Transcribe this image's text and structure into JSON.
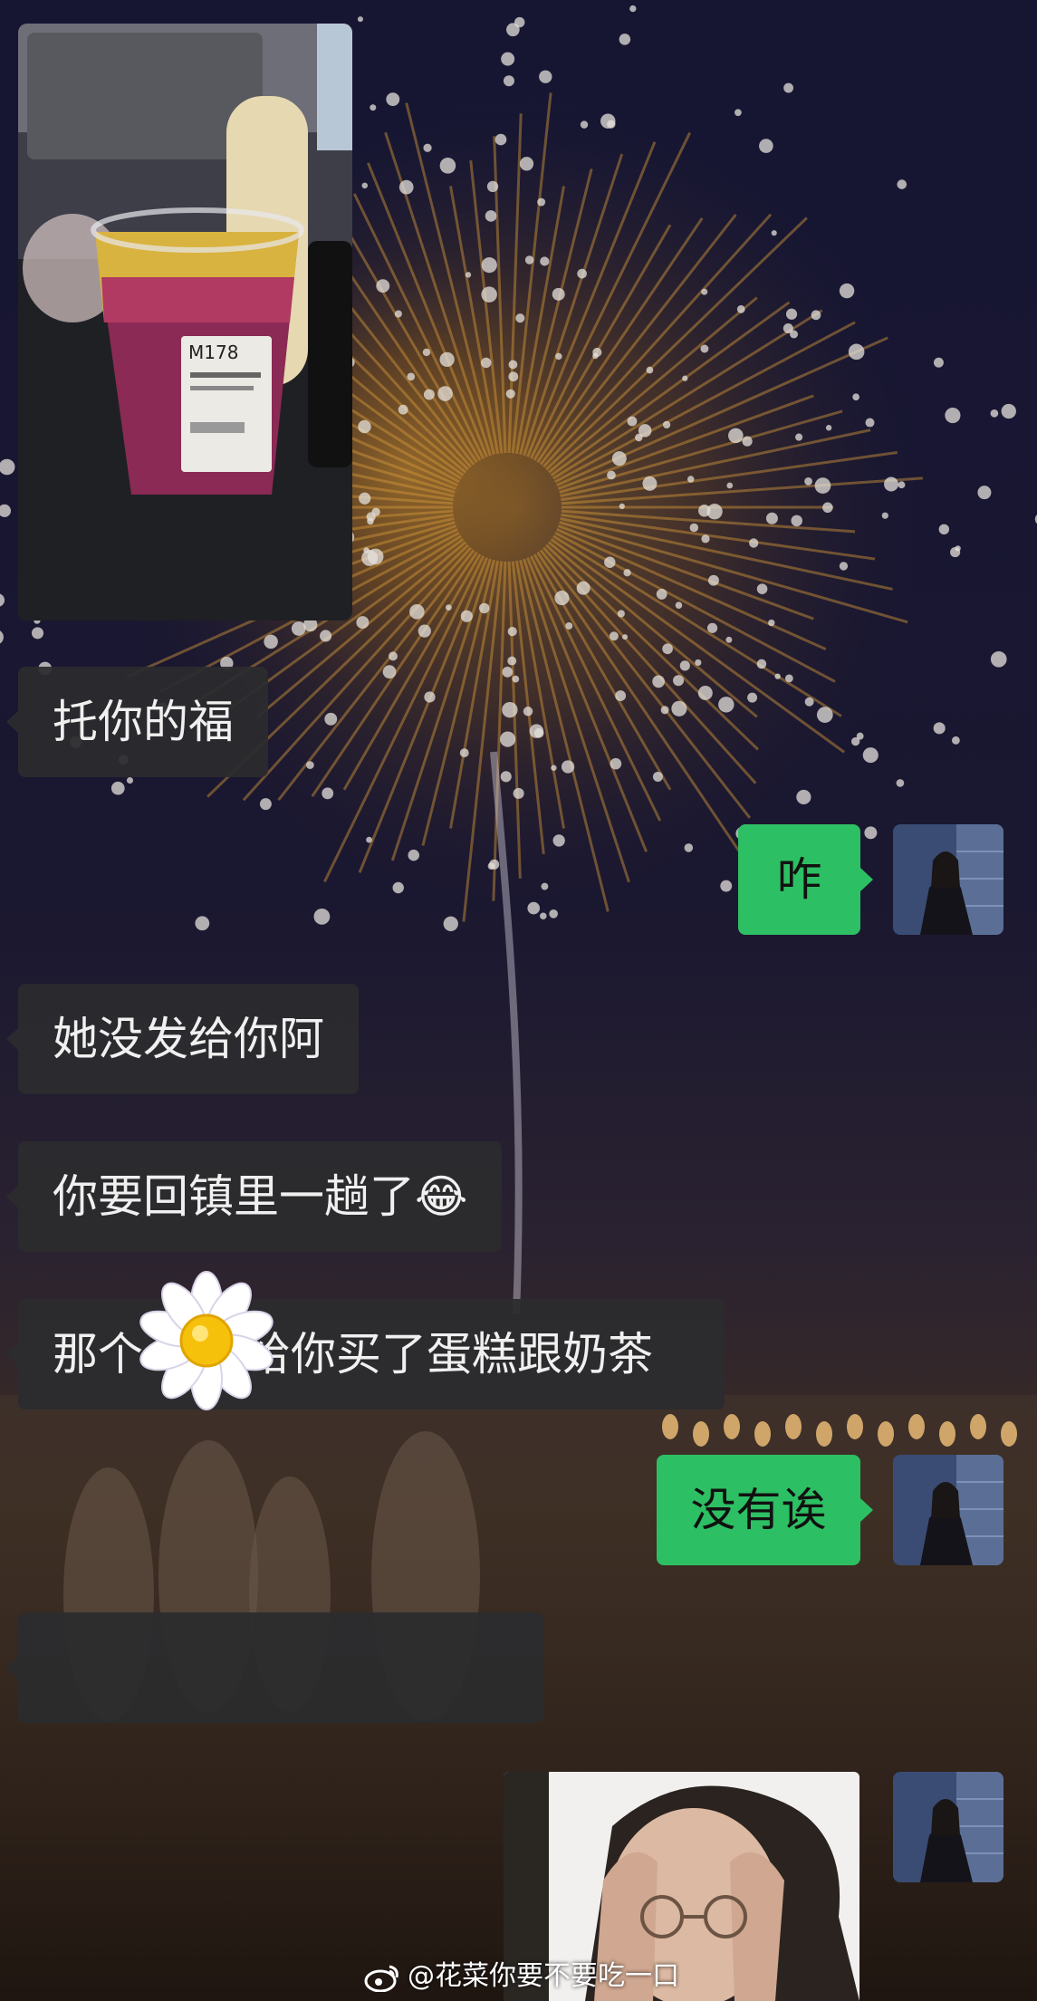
{
  "chat": {
    "messages": [
      {
        "side": "left",
        "type": "image",
        "alt": "drink-photo"
      },
      {
        "side": "left",
        "type": "text",
        "text": "托你的福"
      },
      {
        "side": "right",
        "type": "text",
        "text": "咋"
      },
      {
        "side": "left",
        "type": "text",
        "text": "她没发给你阿"
      },
      {
        "side": "left",
        "type": "text",
        "text": "你要回镇里一趟了😂"
      },
      {
        "side": "left",
        "type": "text",
        "text_before": "那个",
        "text_after": "给你买了蛋糕跟奶茶",
        "sticker": "daisy-sticker"
      },
      {
        "side": "right",
        "type": "text",
        "text": "没有诶"
      },
      {
        "side": "left",
        "type": "text",
        "text": ""
      },
      {
        "side": "right",
        "type": "image",
        "alt": "meme-photo"
      }
    ],
    "cup_label": "M178",
    "watermark": "@花菜你要不要吃一口"
  },
  "colors": {
    "outgoing_bubble": "#2dbf63",
    "incoming_bubble": "#2c2c2e",
    "background": "#17162a"
  }
}
